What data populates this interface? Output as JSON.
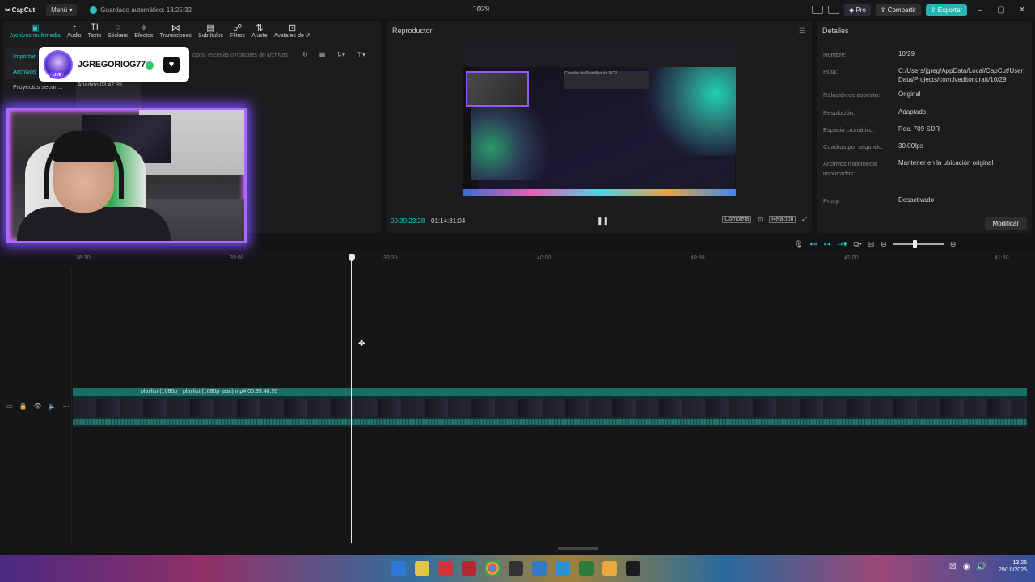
{
  "titlebar": {
    "logo": "CapCut",
    "menu": "Menú",
    "autosave": "Guardado automático: 13:25:32",
    "project": "1029",
    "pro": "Pro",
    "share": "Compartir",
    "export": "Exportar"
  },
  "categories": [
    {
      "label": "Archivos multimedia",
      "icon": "▣"
    },
    {
      "label": "Audio",
      "icon": "◔"
    },
    {
      "label": "Texto",
      "icon": "TI"
    },
    {
      "label": "Stickers",
      "icon": "◌"
    },
    {
      "label": "Efectos",
      "icon": "✧"
    },
    {
      "label": "Transiciones",
      "icon": "⋈"
    },
    {
      "label": "Subtítulos",
      "icon": "▤"
    },
    {
      "label": "Filtros",
      "icon": "☍"
    },
    {
      "label": "Ajuste",
      "icon": "⇅"
    },
    {
      "label": "Avatares de IA",
      "icon": "⊡"
    }
  ],
  "media_side": {
    "import": "Importar",
    "archives": "Archivos",
    "secondary": "Proyectos secun..."
  },
  "media": {
    "search_placeholder": "ogos, escenas o nombres de archivos",
    "thumb_label": "Añadido",
    "thumb_time": "03:47:39"
  },
  "player": {
    "title": "Reproductor",
    "current_time": "00:39:23:28",
    "total_time": "01:14:31:04",
    "full": "Completa",
    "ratio": "Relación",
    "preview_heading": "Creador de Plantillas de DCP"
  },
  "details": {
    "title": "Detalles",
    "rows": [
      {
        "label": "Nombre:",
        "value": "10/29"
      },
      {
        "label": "Ruta:",
        "value": "C:/Users/jgreg/AppData/Local/CapCut/User Data/Projects/com.lveditor.draft/10/29"
      },
      {
        "label": "Relación de aspecto:",
        "value": "Original"
      },
      {
        "label": "Resolución:",
        "value": "Adaptado"
      },
      {
        "label": "Espacio cromático:",
        "value": "Rec. 709 SDR"
      },
      {
        "label": "Cuadros por segundo:",
        "value": "30.00fps"
      },
      {
        "label": "Archivos multimedia importados:",
        "value": "Mantener en la ubicación original"
      },
      {
        "label": "Proxy:",
        "value": "Desactivado"
      }
    ],
    "modify": "Modificar"
  },
  "ruler": [
    "38:30",
    "39:00",
    "39:30",
    "40:00",
    "40:30",
    "41:00",
    "41:30"
  ],
  "clip": {
    "label1": "playlist (1080p_",
    "label2": "playlist (1080p_aac).mp4   00:35:40:26"
  },
  "badge": {
    "name": "JGREGORIOG77",
    "live": "LIVE"
  },
  "tray": {
    "time": "13:26",
    "date": "29/10/2025"
  },
  "colors": {
    "accent": "#24c9c1",
    "export": "#22b5b2",
    "webcam_glow": "#a46cff"
  }
}
